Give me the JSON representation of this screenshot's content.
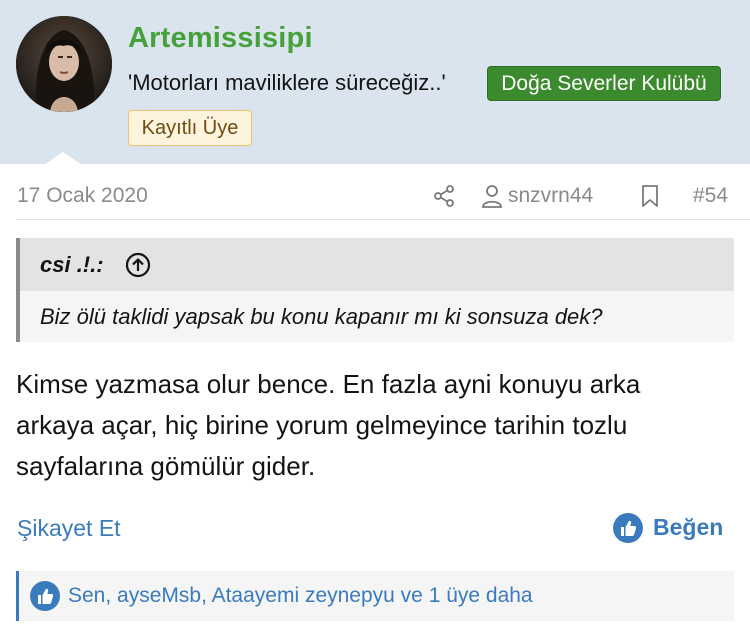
{
  "user": {
    "avatar_icon": "user-avatar-photo",
    "username": "Artemissisipi",
    "title": "'Motorları maviliklere süreceğiz..'",
    "club_badge": "Doğa Severler Kulübü",
    "member_badge": "Kayıtlı Üye"
  },
  "post": {
    "date": "17 Ocak 2020",
    "author": "snzvrn44",
    "number": "#54",
    "share_icon": "share-icon",
    "user_icon": "user-icon",
    "bookmark_icon": "bookmark-icon"
  },
  "quote": {
    "author": "csi .!.:",
    "jump_icon": "arrow-up-circle-icon",
    "text": "Biz ölü taklidi yapsak bu konu kapanır mı ki sonsuza dek?"
  },
  "body": {
    "lines": [
      "Kimse yazmasa olur bence. En fazla ayni konuyu arka",
      "arkaya açar, hiç birine yorum gelmeyince tarihin tozlu",
      "sayfalarına gömülür gider."
    ]
  },
  "actions": {
    "report": "Şikayet Et",
    "like": "Beğen",
    "like_icon": "thumbs-up-icon"
  },
  "reactions": {
    "text": "Sen, ayseMsb, Ataayemi zeynepyu ve 1 üye daha",
    "icon": "thumbs-up-icon"
  },
  "colors": {
    "header_bg": "#dae4ee",
    "username": "#47a13a",
    "club_badge": "#3c8a2e",
    "link": "#3a7bbd",
    "muted": "#8a8a8a"
  }
}
